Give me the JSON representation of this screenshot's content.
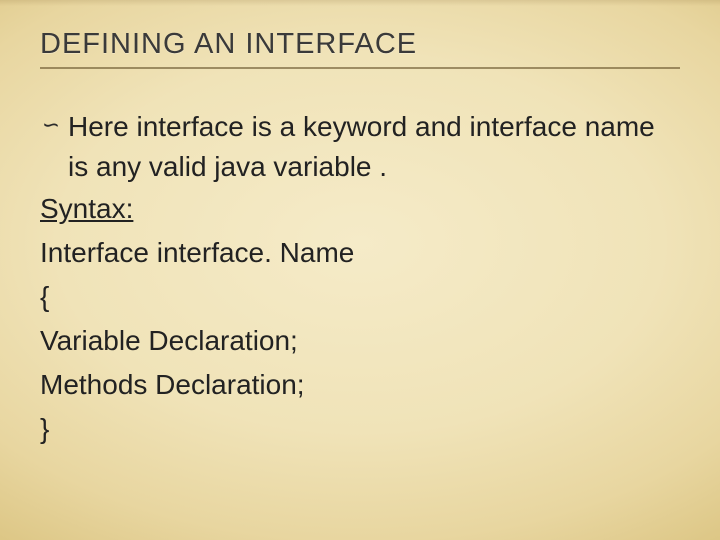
{
  "title": "DEFINING AN INTERFACE",
  "bullet": {
    "icon": "∽",
    "text": "Here interface is a keyword and interface name is any valid java variable ."
  },
  "lines": {
    "syntax": "Syntax:",
    "l1": "Interface interface. Name",
    "l2": "{",
    "l3": "Variable Declaration;",
    "l4": "Methods Declaration;",
    "l5": "}"
  }
}
